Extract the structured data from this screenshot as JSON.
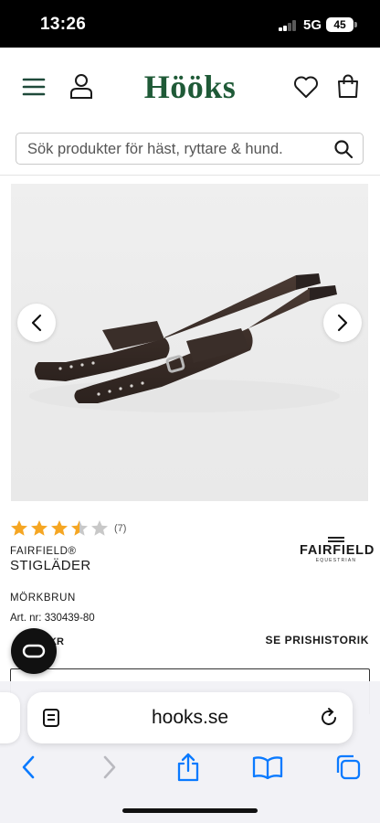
{
  "status_bar": {
    "time": "13:26",
    "network": "5G",
    "battery": "45"
  },
  "header": {
    "logo": "Hööks",
    "icons": [
      "menu-icon",
      "account-icon",
      "wishlist-heart-icon",
      "cart-bag-icon"
    ]
  },
  "search": {
    "placeholder": "Sök produkter för häst, ryttare & hund.",
    "icon": "search-icon"
  },
  "product": {
    "rating_value": 3.5,
    "rating_max": 5,
    "rating_count": "(7)",
    "brand": "FAIRFIELD®",
    "name": "STIGLÄDER",
    "brand_logo": {
      "name": "FAIRFIELD",
      "sub": "EQUESTRIAN"
    },
    "color": "MÖRKBRUN",
    "article_number": "Art. nr: 330439-80",
    "price_partial": "KR",
    "price_history_link": "SE PRISHISTORIK"
  },
  "carousel": {
    "prev_icon": "chevron-left-icon",
    "next_icon": "chevron-right-icon"
  },
  "browser": {
    "url": "hooks.se",
    "icons": [
      "reader-icon",
      "reload-icon",
      "back-icon",
      "forward-icon",
      "share-icon",
      "bookmarks-icon",
      "tabs-icon"
    ]
  },
  "colors": {
    "brand_green": "#1f5a37",
    "star": "#f5a623",
    "star_empty": "#c8c8c8",
    "ios_blue": "#0a7aff"
  }
}
